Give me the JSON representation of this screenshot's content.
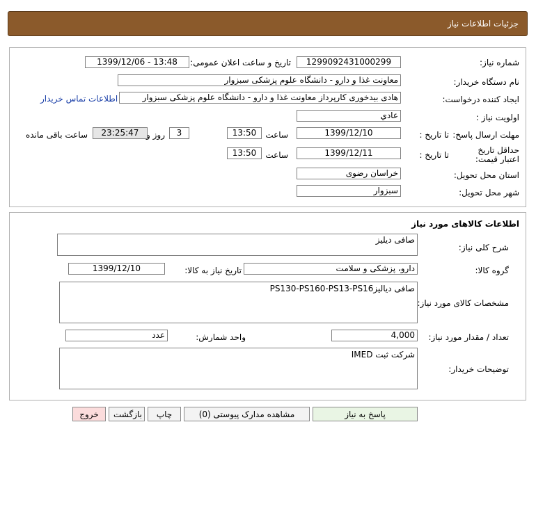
{
  "header": {
    "title": "جزئیات اطلاعات نیاز"
  },
  "info": {
    "need_number_label": "شماره نیاز:",
    "need_number": "1299092431000299",
    "announce_label": "تاریخ و ساعت اعلان عمومی:",
    "announce_value": "1399/12/06 - 13:48",
    "buyer_org_label": "نام دستگاه خریدار:",
    "buyer_org": "معاونت غذا و دارو - دانشگاه علوم پزشکی سبزوار",
    "requester_label": "ایجاد کننده درخواست:",
    "requester": "هادی بیدخوری کارپرداز معاونت غذا و دارو - دانشگاه علوم پزشکی سبزوار",
    "contact_link": "اطلاعات تماس خریدار",
    "priority_label": "اولویت نیاز :",
    "priority": "عادي",
    "reply_deadline_label": "مهلت ارسال پاسخ:",
    "to_date_label": "تا تاریخ :",
    "reply_date": "1399/12/10",
    "time_label": "ساعت",
    "reply_time": "13:50",
    "days_value": "3",
    "days_label": "روز و",
    "remaining_time": "23:25:47",
    "remaining_label": "ساعت باقی مانده",
    "price_validity_label": "حداقل تاریخ اعتبار قیمت:",
    "price_to_date_label": "تا تاریخ :",
    "price_date": "1399/12/11",
    "price_time_label": "ساعت",
    "price_time": "13:50",
    "province_label": "استان محل تحویل:",
    "province": "خراسان رضوی",
    "city_label": "شهر محل تحویل:",
    "city": "سبزوار"
  },
  "goods": {
    "section_title": "اطلاعات کالاهای مورد نیاز",
    "summary_label": "شرح کلی نیاز:",
    "summary": "صافی دیلیز",
    "group_label": "گروه کالا:",
    "group": "دارو، پزشکی و سلامت",
    "need_date_label": "تاریخ نیاز به کالا:",
    "need_date": "1399/12/10",
    "specs_label": "مشخصات کالای مورد نیاز:",
    "specs": "صافی دیالیزPS130-PS160-PS13-PS16",
    "quantity_label": "تعداد / مقدار مورد نیاز:",
    "quantity": "4,000",
    "unit_label": "واحد شمارش:",
    "unit": "عدد",
    "buyer_notes_label": "توضیحات خریدار:",
    "buyer_notes": "شرکت ثبت IMED"
  },
  "buttons": {
    "reply": "پاسخ به نیاز",
    "attachments": "مشاهده مدارک پیوستی (0)",
    "print": "چاپ",
    "back": "بازگشت",
    "exit": "خروج"
  }
}
